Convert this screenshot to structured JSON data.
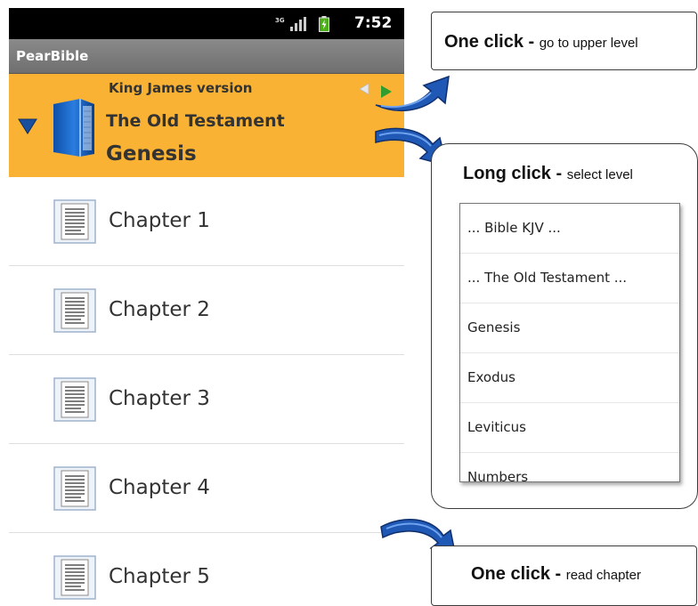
{
  "status": {
    "network": "3G",
    "time": "7:52"
  },
  "app": {
    "title": "PearBible"
  },
  "header": {
    "version": "King James version",
    "testament": "The Old Testament",
    "book": "Genesis"
  },
  "chapters": [
    {
      "label": "Chapter 1"
    },
    {
      "label": "Chapter 2"
    },
    {
      "label": "Chapter 3"
    },
    {
      "label": "Chapter 4"
    },
    {
      "label": "Chapter 5"
    }
  ],
  "callouts": {
    "upper": {
      "action": "One click",
      "sep": " - ",
      "desc": "go to upper level"
    },
    "long": {
      "action": "Long click",
      "sep": " - ",
      "desc": "select level"
    },
    "read": {
      "action": "One click",
      "sep": " - ",
      "desc": "read chapter"
    }
  },
  "level_menu": {
    "items": [
      "... Bible KJV ...",
      "... The Old Testament ...",
      "Genesis",
      "Exodus",
      "Leviticus",
      "Numbers"
    ]
  },
  "colors": {
    "header_bg": "#f9b233",
    "titlebar_bg": "#7b7b7b",
    "arrow_blue": "#1f58b5",
    "expand_triangle": "#1a4f9e"
  }
}
